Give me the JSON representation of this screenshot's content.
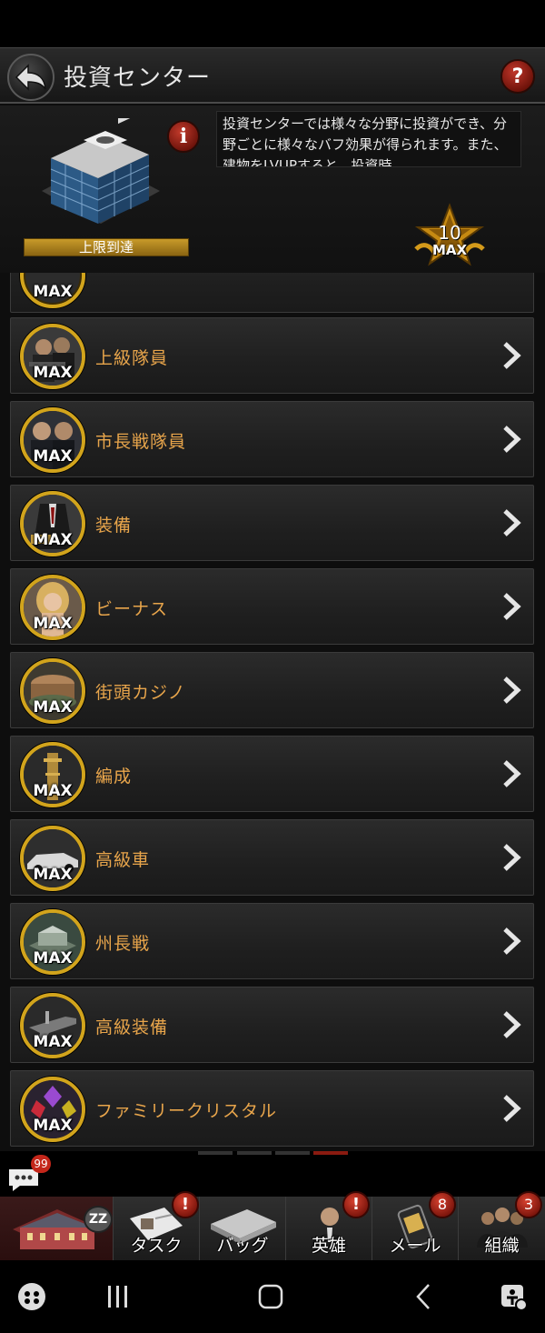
{
  "header": {
    "title": "投資センター",
    "help": "?"
  },
  "info": {
    "description": "投資センターでは様々な分野に投資ができ、分野ごとに様々なバフ効果が得られます。また、建物をLVUPすると、投資時",
    "reach_label": "上限到達",
    "info_glyph": "i",
    "level_number": "10",
    "level_max": "MAX"
  },
  "list": {
    "max_label": "MAX",
    "items": [
      {
        "label": "",
        "icon": "partial-avatar"
      },
      {
        "label": "上級隊員",
        "icon": "gunmen-avatar"
      },
      {
        "label": "市長戦隊員",
        "icon": "soldiers-avatar"
      },
      {
        "label": "装備",
        "icon": "suit-avatar"
      },
      {
        "label": "ビーナス",
        "icon": "venus-avatar"
      },
      {
        "label": "街頭カジノ",
        "icon": "casino-avatar"
      },
      {
        "label": "編成",
        "icon": "tower-avatar"
      },
      {
        "label": "高級車",
        "icon": "car-avatar"
      },
      {
        "label": "州長戦",
        "icon": "state-building-avatar"
      },
      {
        "label": "高級装備",
        "icon": "weapon-avatar"
      },
      {
        "label": "ファミリークリスタル",
        "icon": "crystal-avatar"
      }
    ]
  },
  "chat": {
    "badge": "99"
  },
  "nav": {
    "home_badge": "ZZ",
    "task": "タスク",
    "task_badge": "!",
    "bag": "バッグ",
    "hero": "英雄",
    "hero_badge": "!",
    "mail": "メール",
    "mail_badge": "8",
    "org": "組織",
    "org_badge": "3"
  },
  "colors": {
    "accent_gold": "#d2a41c",
    "label_orange": "#e8a54b",
    "badge_red": "#c4261a"
  }
}
